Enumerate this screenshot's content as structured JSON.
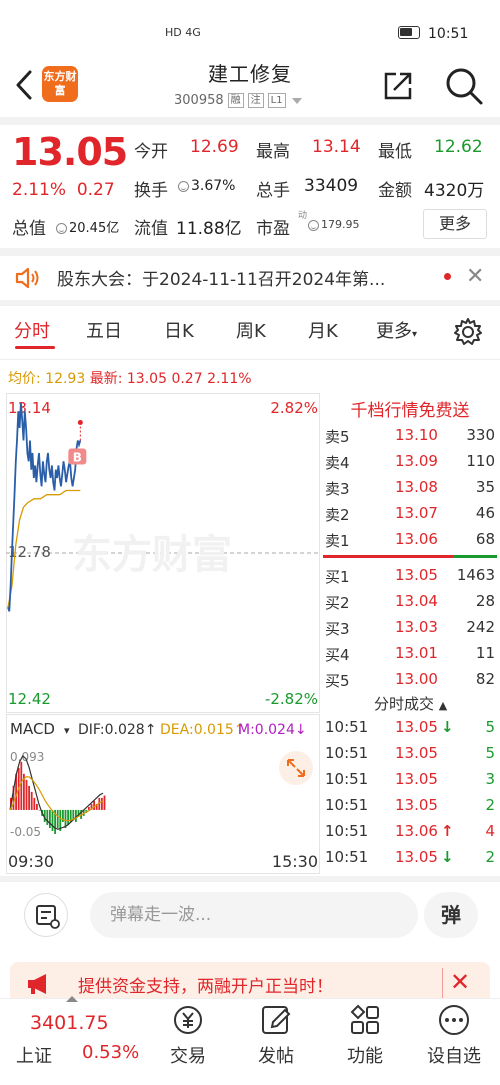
{
  "status_bar": {
    "network": "HD 4G",
    "time": "10:51"
  },
  "header": {
    "logo_text": "东方财富",
    "title": "建工修复",
    "code": "300958",
    "tags": [
      "融",
      "注",
      "L1"
    ]
  },
  "quote": {
    "price": "13.05",
    "change_pct": "2.11%",
    "change": "0.27",
    "open_label": "今开",
    "open": "12.69",
    "high_label": "最高",
    "high": "13.14",
    "low_label": "最低",
    "low": "12.62",
    "turnover_label": "换手",
    "turnover": "3.67%",
    "volume_label": "总手",
    "volume": "33409",
    "amount_label": "金额",
    "amount": "4320万",
    "mcap_label": "总值",
    "mcap": "20.45亿",
    "float_label": "流值",
    "float_mcap": "11.88亿",
    "pe_label": "市盈",
    "pe_sup": "动",
    "pe": "179.95",
    "more_label": "更多"
  },
  "notice": {
    "text": "股东大会：于2024-11-11召开2024年第..."
  },
  "tabs": [
    "分时",
    "五日",
    "日K",
    "周K",
    "月K",
    "更多"
  ],
  "avg_line": {
    "avg_label": "均价:",
    "avg": "12.93",
    "latest_label": "最新:",
    "latest": "13.05",
    "chg": "0.27",
    "pct": "2.11%"
  },
  "chart_data": {
    "type": "line",
    "title": "",
    "y_top": "13.14",
    "y_mid": "12.78",
    "y_bottom": "12.42",
    "pct_top": "2.82%",
    "pct_bottom": "-2.82%",
    "ylim": [
      12.42,
      13.14
    ],
    "x_start": "09:30",
    "x_end": "15:30",
    "x_total_minutes": 240,
    "price_series": [
      [
        0,
        12.65
      ],
      [
        1,
        12.64
      ],
      [
        2,
        12.7
      ],
      [
        3,
        12.78
      ],
      [
        4,
        12.85
      ],
      [
        5,
        12.92
      ],
      [
        6,
        13.0
      ],
      [
        7,
        13.05
      ],
      [
        8,
        13.12
      ],
      [
        9,
        13.08
      ],
      [
        10,
        13.14
      ],
      [
        11,
        13.1
      ],
      [
        12,
        13.05
      ],
      [
        13,
        13.12
      ],
      [
        14,
        13.08
      ],
      [
        15,
        13.02
      ],
      [
        16,
        13.0
      ],
      [
        17,
        13.05
      ],
      [
        18,
        12.98
      ],
      [
        19,
        13.02
      ],
      [
        20,
        12.96
      ],
      [
        21,
        12.99
      ],
      [
        22,
        12.95
      ],
      [
        23,
        12.99
      ],
      [
        24,
        13.02
      ],
      [
        25,
        12.97
      ],
      [
        26,
        12.94
      ],
      [
        27,
        13.0
      ],
      [
        28,
        12.97
      ],
      [
        29,
        12.95
      ],
      [
        30,
        13.0
      ],
      [
        31,
        13.02
      ],
      [
        32,
        12.98
      ],
      [
        33,
        12.96
      ],
      [
        34,
        12.99
      ],
      [
        35,
        12.95
      ],
      [
        36,
        12.93
      ],
      [
        37,
        12.98
      ],
      [
        38,
        12.96
      ],
      [
        39,
        12.99
      ],
      [
        40,
        12.96
      ],
      [
        41,
        12.94
      ],
      [
        42,
        12.97
      ],
      [
        43,
        13.0
      ],
      [
        44,
        12.98
      ],
      [
        45,
        12.95
      ],
      [
        46,
        12.97
      ],
      [
        47,
        12.99
      ],
      [
        48,
        13.0
      ],
      [
        49,
        12.96
      ],
      [
        50,
        12.94
      ],
      [
        51,
        12.96
      ],
      [
        52,
        12.98
      ],
      [
        53,
        13.03
      ],
      [
        54,
        13.05
      ],
      [
        55,
        13.04
      ],
      [
        56,
        13.05
      ]
    ],
    "avg_series": [
      [
        0,
        12.65
      ],
      [
        3,
        12.7
      ],
      [
        6,
        12.8
      ],
      [
        9,
        12.86
      ],
      [
        12,
        12.89
      ],
      [
        15,
        12.9
      ],
      [
        20,
        12.91
      ],
      [
        25,
        12.91
      ],
      [
        30,
        12.92
      ],
      [
        35,
        12.92
      ],
      [
        40,
        12.92
      ],
      [
        45,
        12.93
      ],
      [
        50,
        12.93
      ],
      [
        56,
        12.93
      ]
    ],
    "buy_marker": "B",
    "macd": {
      "label": "MACD",
      "dif_label": "DIF:",
      "dif": "0.028",
      "dea_label": "DEA:",
      "dea": "0.015",
      "m_label": "M:",
      "m": "0.024",
      "top": "0.093",
      "bottom": "-0.05",
      "ylim": [
        -0.05,
        0.093
      ],
      "hist": [
        0.02,
        0.04,
        0.06,
        0.07,
        0.08,
        0.06,
        0.05,
        0.04,
        0.03,
        0.02,
        0.01,
        0.0,
        -0.01,
        -0.02,
        -0.025,
        -0.03,
        -0.035,
        -0.04,
        -0.03,
        -0.035,
        -0.02,
        -0.03,
        -0.025,
        -0.02,
        -0.015,
        -0.02,
        -0.01,
        -0.015,
        -0.01,
        -0.005,
        0.005,
        0.01,
        0.015,
        0.01,
        0.02,
        0.02,
        0.024
      ],
      "dif_series": [
        0.0,
        0.03,
        0.06,
        0.08,
        0.09,
        0.085,
        0.07,
        0.05,
        0.03,
        0.01,
        -0.005,
        -0.015,
        -0.02,
        -0.025,
        -0.03,
        -0.032,
        -0.03,
        -0.028,
        -0.025,
        -0.02,
        -0.015,
        -0.01,
        -0.005,
        0.0,
        0.005,
        0.01,
        0.015,
        0.02,
        0.025,
        0.028
      ],
      "dea_series": [
        0.0,
        0.01,
        0.025,
        0.04,
        0.05,
        0.055,
        0.055,
        0.05,
        0.043,
        0.035,
        0.025,
        0.015,
        0.007,
        0.0,
        -0.006,
        -0.011,
        -0.015,
        -0.017,
        -0.018,
        -0.017,
        -0.015,
        -0.012,
        -0.009,
        -0.006,
        -0.003,
        0.0,
        0.004,
        0.008,
        0.012,
        0.015
      ]
    }
  },
  "order_book": {
    "banner": "千档行情免费送",
    "asks": [
      {
        "label": "卖5",
        "price": "13.10",
        "vol": "330"
      },
      {
        "label": "卖4",
        "price": "13.09",
        "vol": "110"
      },
      {
        "label": "卖3",
        "price": "13.08",
        "vol": "35"
      },
      {
        "label": "卖2",
        "price": "13.07",
        "vol": "46"
      },
      {
        "label": "卖1",
        "price": "13.06",
        "vol": "68"
      }
    ],
    "bids": [
      {
        "label": "买1",
        "price": "13.05",
        "vol": "1463"
      },
      {
        "label": "买2",
        "price": "13.04",
        "vol": "28"
      },
      {
        "label": "买3",
        "price": "13.03",
        "vol": "242"
      },
      {
        "label": "买4",
        "price": "13.01",
        "vol": "11"
      },
      {
        "label": "买5",
        "price": "13.00",
        "vol": "82"
      }
    ]
  },
  "trades": {
    "title": "分时成交",
    "rows": [
      {
        "time": "10:51",
        "price": "13.05",
        "dir": "↓",
        "vol": "5",
        "color": "#1a9a2e"
      },
      {
        "time": "10:51",
        "price": "13.05",
        "dir": "",
        "vol": "5",
        "color": "#1a9a2e"
      },
      {
        "time": "10:51",
        "price": "13.05",
        "dir": "",
        "vol": "3",
        "color": "#1a9a2e"
      },
      {
        "time": "10:51",
        "price": "13.05",
        "dir": "",
        "vol": "2",
        "color": "#1a9a2e"
      },
      {
        "time": "10:51",
        "price": "13.06",
        "dir": "↑",
        "vol": "4",
        "color": "#e0262a"
      },
      {
        "time": "10:51",
        "price": "13.05",
        "dir": "↓",
        "vol": "2",
        "color": "#1a9a2e"
      }
    ]
  },
  "comment": {
    "placeholder": "弹幕走一波...",
    "dan_label": "弹"
  },
  "promo": {
    "text": "提供资金支持，两融开户正当时！"
  },
  "bottom_nav": {
    "index_value": "3401.75",
    "index_name": "上证",
    "index_pct": "0.53%",
    "items": [
      "交易",
      "发帖",
      "功能",
      "设自选"
    ]
  },
  "colors": {
    "up": "#e0262a",
    "down": "#1a9a2e",
    "accent": "#f06d1e",
    "avg": "#d89a00",
    "price_line": "#2a5ea8"
  }
}
